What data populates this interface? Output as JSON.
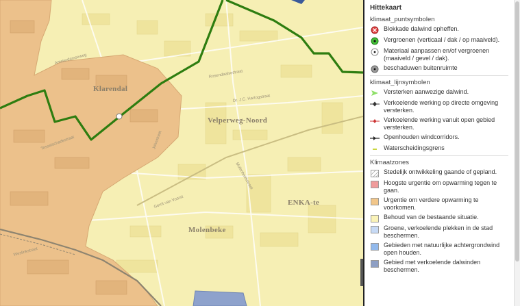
{
  "map": {
    "places": {
      "klarendal": "Klarendal",
      "velperweg_noord": "Velperweg-Noord",
      "molenbeke": "Molenbeke",
      "enka": "ENKA-te"
    },
    "streets": [
      "Rosendaalsestraat",
      "Dr. J.C. Hartogstraat",
      "Johnstraat",
      "Gerrit van Voorst",
      "Molenbeekstraat",
      "Amsterdamseweg",
      "Tesselschadestraat",
      "Weslinkstraat"
    ],
    "colors": {
      "base": "#f6efb4",
      "urban": "#ecc18b",
      "boundary": "#2e7d10",
      "water": "#8ea2cc"
    }
  },
  "legend": {
    "title": "Hittekaart",
    "groups": [
      {
        "name": "klimaat_puntsymbolen",
        "items": [
          {
            "label": "Blokkade dalwind opheffen.",
            "icon": "red-cross-circle-icon",
            "color": "#e04040"
          },
          {
            "label": "Vergroenen (verticaal / dak / op maaiveld).",
            "icon": "green-dot-icon",
            "color": "#44c037"
          },
          {
            "label": "Materiaal aanpassen en/of vergroenen (maaiveld / gevel / dak).",
            "icon": "white-dot-icon",
            "color": "#ffffff"
          },
          {
            "label": "beschaduwen buitenruimte",
            "icon": "grey-dot-icon",
            "color": "#9a9a9a"
          }
        ]
      },
      {
        "name": "klimaat_lijnsymbolen",
        "items": [
          {
            "label": "Versterken aanwezige dalwind.",
            "icon": "green-arrow-icon",
            "color": "#8fe06a"
          },
          {
            "label": "Verkoelende werking op directe omgeving versterken.",
            "icon": "dark-diamond-line-icon",
            "color": "#333333"
          },
          {
            "label": "Verkoelende werking vanuit open gebied versterken.",
            "icon": "red-diamond-line-icon",
            "color": "#cc3333"
          },
          {
            "label": "Openhouden windcorridors.",
            "icon": "black-arrow-line-icon",
            "color": "#222222"
          },
          {
            "label": "Waterscheidingsgrens",
            "icon": "yellow-green-dash-icon",
            "color": "#b8c800"
          }
        ]
      },
      {
        "name": "Klimaatzones",
        "items": [
          {
            "label": "Stedelijk ontwikkeling gaande of gepland.",
            "icon": "hatched-box-icon",
            "color": "#ffffff"
          },
          {
            "label": "Hoogste urgentie om opwarming tegen te gaan.",
            "icon": "pink-box-icon",
            "color": "#ef9a9a"
          },
          {
            "label": "Urgentie om verdere opwarming te voorkomen.",
            "icon": "orange-box-icon",
            "color": "#f1c68a"
          },
          {
            "label": "Behoud van de bestaande situatie.",
            "icon": "yellow-box-icon",
            "color": "#faf3b8"
          },
          {
            "label": "Groene, verkoelende plekken in de stad beschermen.",
            "icon": "light-blue-box-icon",
            "color": "#c7daf5"
          },
          {
            "label": "Gebieden met natuurlijke achtergrondwind open houden.",
            "icon": "blue-box-icon",
            "color": "#92b9ec"
          },
          {
            "label": "Gebied met verkoelende dalwinden beschermen.",
            "icon": "slate-box-icon",
            "color": "#8e9fc4"
          }
        ]
      }
    ]
  }
}
